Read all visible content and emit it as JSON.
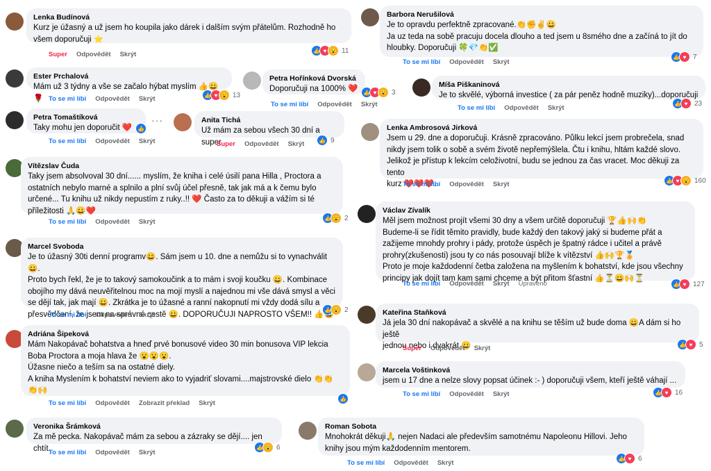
{
  "comments": [
    {
      "name": "Lenka Budínová",
      "lines": [
        "Kurz je úžasný a už jsem ho koupila jako dárek i dalším svým přátelům. Rozhodně ho",
        "všem doporučuji ⭐"
      ],
      "actions": [
        "Super",
        "Odpovědět",
        "Skrýt"
      ],
      "count": "11",
      "avatar": "#8a5a3c"
    },
    {
      "name": "Barbora Nerušilová",
      "lines": [
        "Je to opravdu perfektně zpracované.👏✊✌😀",
        "Ja uz teda na sobě pracuju docela dlouho a ted jsem u 8smého dne a začíná to jít do",
        "hloubky. Doporučuji 🍀💎👏✅"
      ],
      "actions": [
        "To se mi líbí",
        "Odpovědět",
        "Skrýt"
      ],
      "count": "7",
      "avatar": "#6d5a4a"
    },
    {
      "name": "Ester Prchalová",
      "lines": [
        "Mám už 3 týdny a vše se začalo hýbat myslím 👍😀🌹"
      ],
      "actions": [
        "To se mi líbí",
        "Odpovědět",
        "Skrýt"
      ],
      "count": "13",
      "avatar": "#3a3a3a"
    },
    {
      "name": "Petra Hořínková Dvorská",
      "lines": [
        "Doporučuji na 1000% ❤️"
      ],
      "actions": [
        "To se mi líbí",
        "Odpovědět",
        "Skrýt"
      ],
      "count": "3",
      "avatar": "#b8b8b8"
    },
    {
      "name": "Míša Piškaninová",
      "lines": [
        "Je to skvělé, výborná investice ( za pár peněz hodně muziky)...doporučuji"
      ],
      "actions": [
        "To se mi líbí",
        "Odpovědět",
        "Skrýt"
      ],
      "count": "23",
      "avatar": "#3b2a24"
    },
    {
      "name": "Petra Tomaštíková",
      "lines": [
        "Taky mohu jen doporučit ❤️"
      ],
      "actions": [
        "To se mi líbí",
        "Odpovědět",
        "Skrýt"
      ],
      "count": "",
      "avatar": "#2c2c2c"
    },
    {
      "name": "Anita Tichá",
      "lines": [
        "Už mám za sebou všech 30 dní a super"
      ],
      "actions": [
        "Super",
        "Odpovědět",
        "Skrýt"
      ],
      "count": "9",
      "avatar": "#b87050"
    },
    {
      "name": "Lenka Ambrosová Jirková",
      "lines": [
        "Jsem u 29. dne a doporučuji. Krásně zpracováno. Půlku lekcí jsem probrečela, snad",
        "nikdy jsem tolik o sobě a svém životě nepřemýšlela. Čtu i knihu, hltám každé slovo.",
        "Jelikož je přístup k lekcím celoživotní, budu se jednou za čas vracet. Moc děkuji za tento",
        "kurz ❤️❤️❤️."
      ],
      "actions": [
        "To se mi líbí",
        "Odpovědět",
        "Skrýt"
      ],
      "count": "160",
      "avatar": "#a09080"
    },
    {
      "name": "Vítězslav Čuda",
      "lines": [
        "Taky jsem absolvoval 30 dní...... myslím, že kniha i celé úsilí pana Hilla , Proctora a",
        "ostatních nebylo marné a splnilo a plní svůj účel přesně, tak jak má a k čemu bylo",
        "určené... Tu knihu už nikdy nepustím z ruky..!! ❤️ Často za to děkuji a vážím si té",
        "příležitosti 🙏😀❤️"
      ],
      "actions": [
        "To se mi líbí",
        "Odpovědět",
        "Skrýt"
      ],
      "count": "2",
      "avatar": "#4a6a3a"
    },
    {
      "name": "Václav Zívalík",
      "lines": [
        "Měl jsem možnost projít všemi 30 dny a všem určitě doporučuji 🏆👍🙌👏",
        "Budeme-li se řídit těmito pravidly, bude každý den takový jaký si budeme přát a",
        "zažijeme mnohdy prohry i pády, protože úspěch je špatný rádce i učitel a právě",
        "prohry(zkušenosti) jsou ty co nás posouvají blíže k vítězství 👍🙌🏆🏅",
        "Proto je moje každodenní četba založena na myšlením k bohatství, kde jsou všechny",
        "principy jak dojít tam kam sami chceme a být přitom šťastní 👍⏳😀🙌⏳"
      ],
      "actions": [
        "To se mi líbí",
        "Odpovědět",
        "Skrýt",
        "Upraveno"
      ],
      "count": "127",
      "avatar": "#222222"
    },
    {
      "name": "Marcel Svoboda",
      "lines": [
        "Je to úžasný 30ti denní programv😀. Sám jsem u 10. dne a nemůžu si to vynachválit 😀.",
        "Proto bych řekl, že je to takový samokoučink a to mám i svoji koučku 😀. Kombinace",
        "obojího my dává neuvěřitelnou moc na mojí myslí a najednou mi vše dává smysl a věci",
        "se dějí tak, jak mají 😀. Zkrátka je to úžasné a ranní nakopnutí mi vždy dodá sílu a",
        "přesvědčení, že jsem na správné cestě 😀. DOPORUČUJI NAPROSTO VŠEM!! 👍😀"
      ],
      "actions": [
        "To se mi líbí",
        "Odpovědět",
        "Skrýt"
      ],
      "count": "2",
      "avatar": "#6a5a4a"
    },
    {
      "name": "Kateřina Staňková",
      "lines": [
        "Já jela 30 dní nakopávač a skvělé a na knihu se těším už bude doma 😀A dám si ho ještě",
        "jednou nebo i dvakrát 😀"
      ],
      "actions": [
        "Super",
        "Odpovědět",
        "Skrýt"
      ],
      "count": "5",
      "avatar": "#4a3a2a"
    },
    {
      "name": "Adriána Šipeková",
      "lines": [
        "Mám Nakopávač bohatstva a hneď prvé bonusové video 30 min bonusova VIP lekcia",
        "Boba Proctora a moja hlava že 😮😮😮.",
        "Úžasne niečo a teším sa na ostatné diely.",
        "A kniha Myslením k bohatství neviem ako to vyjadriť slovami....majstrovské dielo 👏👏",
        "👏🙌"
      ],
      "actions": [
        "To se mi líbí",
        "Odpovědět",
        "Zobrazit překlad",
        "Skrýt"
      ],
      "count": "",
      "avatar": "#c84a3a"
    },
    {
      "name": "Marcela Voštinková",
      "lines": [
        "jsem u 17 dne a nelze slovy popsat účinek :- ) doporučuji všem, kteří ještě váhají ..."
      ],
      "actions": [
        "To se mi líbí",
        "Odpovědět",
        "Skrýt"
      ],
      "count": "16",
      "avatar": "#b8a898"
    },
    {
      "name": "Veronika Šrámková",
      "lines": [
        "Za mě pecka. Nakopávač mám za sebou a zázraky se dějí.... jen chtít."
      ],
      "actions": [
        "To se mi líbí",
        "Odpovědět",
        "Skrýt"
      ],
      "count": "6",
      "avatar": "#5a6a4a"
    },
    {
      "name": "Roman Sobota",
      "lines": [
        "Mnohokrát děkuji🙏 nejen Nadaci ale především samotnému Napoleonu Hillovi. Jeho",
        "knihy jsou mým každodenním mentorem."
      ],
      "actions": [
        "To se mi líbí",
        "Odpovědět",
        "Skrýt"
      ],
      "count": "6",
      "avatar": "#8a7a6a"
    }
  ]
}
